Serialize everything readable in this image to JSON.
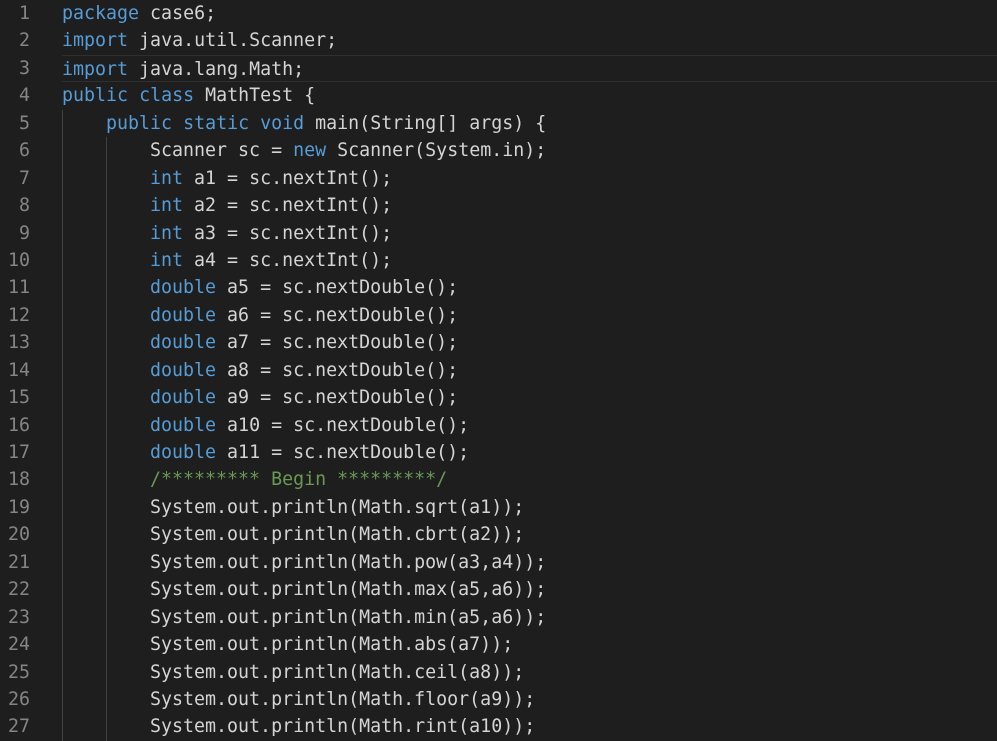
{
  "editor": {
    "language": "java",
    "colors": {
      "background": "#1e1e1e",
      "text": "#d4d4d4",
      "keyword": "#569cd6",
      "comment": "#6a9955",
      "line_number": "#858585"
    },
    "lines": [
      {
        "number": "1",
        "indent": 0,
        "tokens": [
          {
            "t": "package",
            "c": "kw"
          },
          {
            "t": " case6;",
            "c": "tx"
          }
        ]
      },
      {
        "number": "2",
        "indent": 0,
        "tokens": [
          {
            "t": "import",
            "c": "kw"
          },
          {
            "t": " java.util.Scanner;",
            "c": "tx"
          }
        ]
      },
      {
        "number": "3",
        "indent": 0,
        "tokens": [
          {
            "t": "import",
            "c": "kw"
          },
          {
            "t": " java.lang.Math;",
            "c": "tx"
          }
        ]
      },
      {
        "number": "4",
        "indent": 0,
        "tokens": [
          {
            "t": "public",
            "c": "kw"
          },
          {
            "t": " ",
            "c": "tx"
          },
          {
            "t": "class",
            "c": "kw"
          },
          {
            "t": " MathTest {",
            "c": "tx"
          }
        ]
      },
      {
        "number": "5",
        "indent": 1,
        "tokens": [
          {
            "t": "public",
            "c": "kw"
          },
          {
            "t": " ",
            "c": "tx"
          },
          {
            "t": "static",
            "c": "kw"
          },
          {
            "t": " ",
            "c": "tx"
          },
          {
            "t": "void",
            "c": "kw"
          },
          {
            "t": " main(String[] args) {",
            "c": "tx"
          }
        ]
      },
      {
        "number": "6",
        "indent": 2,
        "tokens": [
          {
            "t": "Scanner sc = ",
            "c": "tx"
          },
          {
            "t": "new",
            "c": "kw"
          },
          {
            "t": " Scanner(System.in);",
            "c": "tx"
          }
        ]
      },
      {
        "number": "7",
        "indent": 2,
        "tokens": [
          {
            "t": "int",
            "c": "kw"
          },
          {
            "t": " a1 = sc.nextInt();",
            "c": "tx"
          }
        ]
      },
      {
        "number": "8",
        "indent": 2,
        "tokens": [
          {
            "t": "int",
            "c": "kw"
          },
          {
            "t": " a2 = sc.nextInt();",
            "c": "tx"
          }
        ]
      },
      {
        "number": "9",
        "indent": 2,
        "tokens": [
          {
            "t": "int",
            "c": "kw"
          },
          {
            "t": " a3 = sc.nextInt();",
            "c": "tx"
          }
        ]
      },
      {
        "number": "10",
        "indent": 2,
        "tokens": [
          {
            "t": "int",
            "c": "kw"
          },
          {
            "t": " a4 = sc.nextInt();",
            "c": "tx"
          }
        ]
      },
      {
        "number": "11",
        "indent": 2,
        "tokens": [
          {
            "t": "double",
            "c": "kw"
          },
          {
            "t": " a5 = sc.nextDouble();",
            "c": "tx"
          }
        ]
      },
      {
        "number": "12",
        "indent": 2,
        "tokens": [
          {
            "t": "double",
            "c": "kw"
          },
          {
            "t": " a6 = sc.nextDouble();",
            "c": "tx"
          }
        ]
      },
      {
        "number": "13",
        "indent": 2,
        "tokens": [
          {
            "t": "double",
            "c": "kw"
          },
          {
            "t": " a7 = sc.nextDouble();",
            "c": "tx"
          }
        ]
      },
      {
        "number": "14",
        "indent": 2,
        "tokens": [
          {
            "t": "double",
            "c": "kw"
          },
          {
            "t": " a8 = sc.nextDouble();",
            "c": "tx"
          }
        ]
      },
      {
        "number": "15",
        "indent": 2,
        "tokens": [
          {
            "t": "double",
            "c": "kw"
          },
          {
            "t": " a9 = sc.nextDouble();",
            "c": "tx"
          }
        ]
      },
      {
        "number": "16",
        "indent": 2,
        "tokens": [
          {
            "t": "double",
            "c": "kw"
          },
          {
            "t": " a10 = sc.nextDouble();",
            "c": "tx"
          }
        ]
      },
      {
        "number": "17",
        "indent": 2,
        "tokens": [
          {
            "t": "double",
            "c": "kw"
          },
          {
            "t": " a11 = sc.nextDouble();",
            "c": "tx"
          }
        ]
      },
      {
        "number": "18",
        "indent": 2,
        "tokens": [
          {
            "t": "/********* Begin *********/",
            "c": "cm"
          }
        ]
      },
      {
        "number": "19",
        "indent": 2,
        "tokens": [
          {
            "t": "System.out.println(Math.sqrt(a1));",
            "c": "tx"
          }
        ]
      },
      {
        "number": "20",
        "indent": 2,
        "tokens": [
          {
            "t": "System.out.println(Math.cbrt(a2));",
            "c": "tx"
          }
        ]
      },
      {
        "number": "21",
        "indent": 2,
        "tokens": [
          {
            "t": "System.out.println(Math.pow(a3,a4));",
            "c": "tx"
          }
        ]
      },
      {
        "number": "22",
        "indent": 2,
        "tokens": [
          {
            "t": "System.out.println(Math.max(a5,a6));",
            "c": "tx"
          }
        ]
      },
      {
        "number": "23",
        "indent": 2,
        "tokens": [
          {
            "t": "System.out.println(Math.min(a5,a6));",
            "c": "tx"
          }
        ]
      },
      {
        "number": "24",
        "indent": 2,
        "tokens": [
          {
            "t": "System.out.println(Math.abs(a7));",
            "c": "tx"
          }
        ]
      },
      {
        "number": "25",
        "indent": 2,
        "tokens": [
          {
            "t": "System.out.println(Math.ceil(a8));",
            "c": "tx"
          }
        ]
      },
      {
        "number": "26",
        "indent": 2,
        "tokens": [
          {
            "t": "System.out.println(Math.floor(a9));",
            "c": "tx"
          }
        ]
      },
      {
        "number": "27",
        "indent": 2,
        "tokens": [
          {
            "t": "System.out.println(Math.rint(a10));",
            "c": "tx"
          }
        ]
      }
    ]
  }
}
